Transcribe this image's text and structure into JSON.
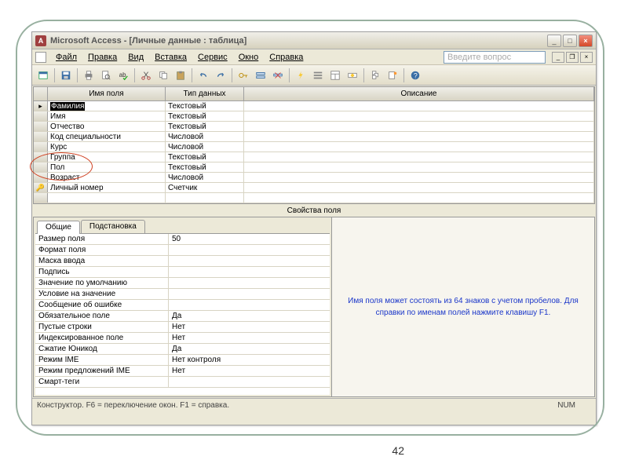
{
  "titlebar": {
    "app_icon_letter": "A",
    "text": "Microsoft Access - [Личные данные : таблица]"
  },
  "menubar": {
    "items": [
      "Файл",
      "Правка",
      "Вид",
      "Вставка",
      "Сервис",
      "Окно",
      "Справка"
    ],
    "help_placeholder": "Введите вопрос"
  },
  "grid": {
    "headers": {
      "name": "Имя поля",
      "type": "Тип данных",
      "desc": "Описание"
    },
    "rows": [
      {
        "name": "Фамилия",
        "type": "Текстовый",
        "selected": true,
        "marker": "▸"
      },
      {
        "name": "Имя",
        "type": "Текстовый"
      },
      {
        "name": "Отчество",
        "type": "Текстовый"
      },
      {
        "name": "Код специальности",
        "type": "Числовой"
      },
      {
        "name": "Курс",
        "type": "Числовой"
      },
      {
        "name": "Группа",
        "type": "Текстовый"
      },
      {
        "name": "Пол",
        "type": "Текстовый"
      },
      {
        "name": "Возраст",
        "type": "Числовой"
      },
      {
        "name": "Личный номер",
        "type": "Счетчик",
        "marker": "🔑"
      },
      {
        "name": "",
        "type": ""
      }
    ]
  },
  "props": {
    "section_label": "Свойства поля",
    "tabs": {
      "general": "Общие",
      "lookup": "Подстановка"
    },
    "rows": [
      {
        "label": "Размер поля",
        "value": "50"
      },
      {
        "label": "Формат поля",
        "value": ""
      },
      {
        "label": "Маска ввода",
        "value": ""
      },
      {
        "label": "Подпись",
        "value": ""
      },
      {
        "label": "Значение по умолчанию",
        "value": ""
      },
      {
        "label": "Условие на значение",
        "value": ""
      },
      {
        "label": "Сообщение об ошибке",
        "value": ""
      },
      {
        "label": "Обязательное поле",
        "value": "Да"
      },
      {
        "label": "Пустые строки",
        "value": "Нет"
      },
      {
        "label": "Индексированное поле",
        "value": "Нет"
      },
      {
        "label": "Сжатие Юникод",
        "value": "Да"
      },
      {
        "label": "Режим IME",
        "value": "Нет контроля"
      },
      {
        "label": "Режим предложений IME",
        "value": "Нет"
      },
      {
        "label": "Смарт-теги",
        "value": ""
      }
    ],
    "hint": "Имя поля может состоять из 64 знаков с учетом пробелов.  Для справки по именам полей нажмите клавишу F1."
  },
  "statusbar": {
    "left": "Конструктор.  F6 = переключение окон.  F1 = справка.",
    "num": "NUM"
  },
  "page_number": "42"
}
